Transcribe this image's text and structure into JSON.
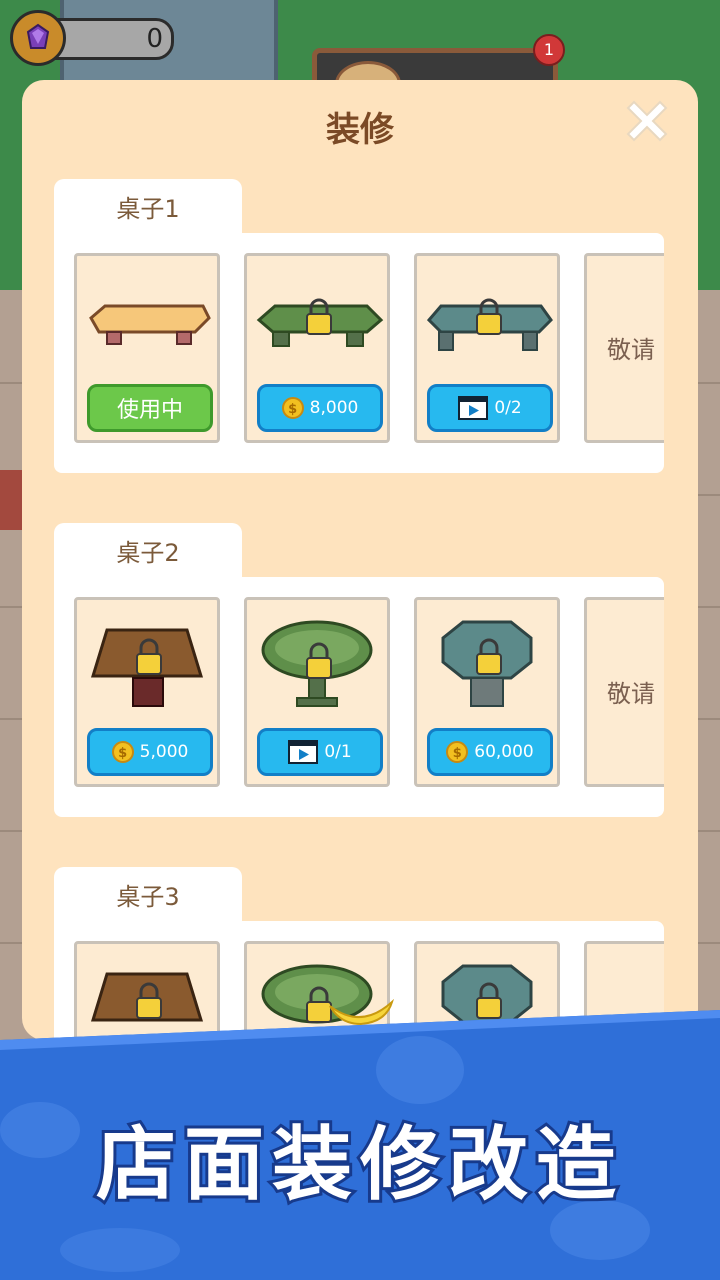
{
  "hud": {
    "gem_count": "0",
    "notification_count": "1"
  },
  "modal": {
    "title": "装修"
  },
  "sections": [
    {
      "tab": "桌子1",
      "items": [
        {
          "state": "in-use",
          "label": "使用中"
        },
        {
          "state": "coin",
          "label": "8,000"
        },
        {
          "state": "video",
          "label": "0/2"
        }
      ],
      "more": "敬请"
    },
    {
      "tab": "桌子2",
      "items": [
        {
          "state": "coin",
          "label": "5,000"
        },
        {
          "state": "video",
          "label": "0/1"
        },
        {
          "state": "coin",
          "label": "60,000"
        }
      ],
      "more": "敬请"
    },
    {
      "tab": "桌子3",
      "items": [],
      "more": ""
    }
  ],
  "banner": {
    "text": "店面装修改造"
  },
  "icons": [
    "gem-icon",
    "close-icon",
    "lock-icon",
    "coin-icon",
    "video-icon"
  ],
  "colors": {
    "panel_bg": "#fee3be",
    "green_button": "#6cc84a",
    "blue_button": "#27b9ef",
    "banner_blue": "#2f6fd8"
  }
}
